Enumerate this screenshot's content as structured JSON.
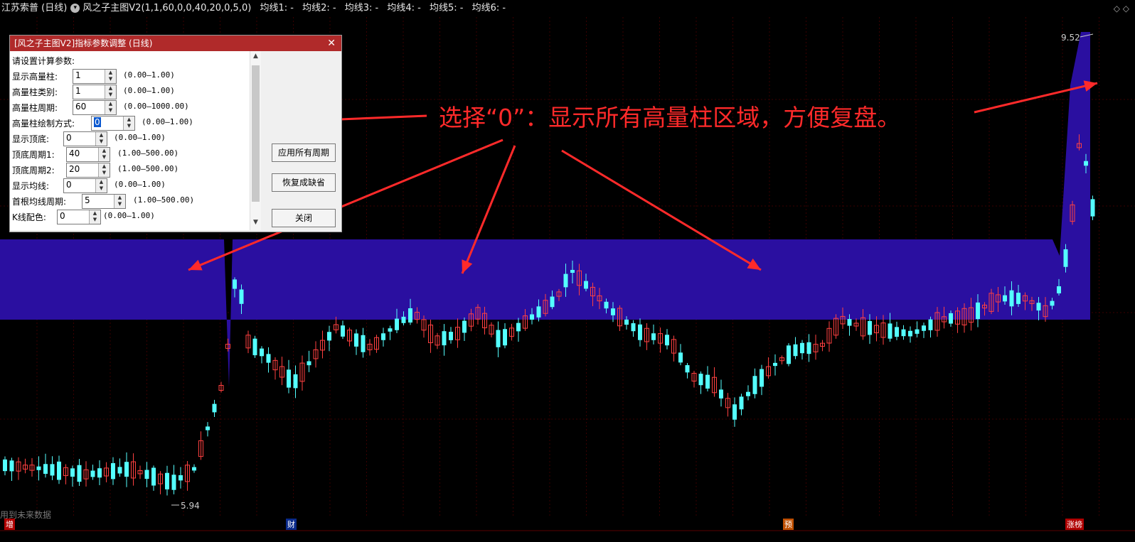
{
  "header": {
    "stock_name": "江苏索普 (日线)",
    "indicator_icon": "chevron-circle-icon",
    "indicator": "风之子主图V2(1,1,60,0,0,40,20,0,5,0)",
    "mas": [
      "均线1: -",
      "均线2: -",
      "均线3: -",
      "均线4: -",
      "均线5: -",
      "均线6: -"
    ],
    "corner": "◇ ◇"
  },
  "chart": {
    "high_label": "9.52",
    "low_label": "5.94",
    "colors": {
      "up": "#ff4040",
      "down": "#54ffff",
      "zone": "#2a0fa0",
      "grid": "#3a0000"
    }
  },
  "annotation": {
    "text": "选择“0”：显示所有高量柱区域，方便复盘。",
    "color": "#ff2a2a"
  },
  "dialog": {
    "title": "[风之子主图V2]指标参数调整 (日线)",
    "close_icon": "close-icon",
    "intro": "请设置计算参数:",
    "params": [
      {
        "label": "显示高量柱:",
        "value": "1",
        "range": "(0.00—1.00)"
      },
      {
        "label": "高量柱类别:",
        "value": "1",
        "range": "(0.00—1.00)"
      },
      {
        "label": "高量柱周期:",
        "value": "60",
        "range": "(0.00—1000.00)"
      },
      {
        "label": "高量柱绘制方式:",
        "value": "0",
        "range": "(0.00—1.00)"
      },
      {
        "label": "显示顶底:",
        "value": "0",
        "range": "(0.00—1.00)"
      },
      {
        "label": "顶底周期1:",
        "value": "40",
        "range": "(1.00—500.00)"
      },
      {
        "label": "顶底周期2:",
        "value": "20",
        "range": "(1.00—500.00)"
      },
      {
        "label": "显示均线:",
        "value": "0",
        "range": "(0.00—1.00)"
      },
      {
        "label": "首根均线周期:",
        "value": "5",
        "range": "(1.00—500.00)"
      },
      {
        "label": "K线配色:",
        "value": "0",
        "range": "(0.00—1.00)"
      }
    ],
    "buttons": {
      "apply_all": "应用所有周期",
      "restore": "恢复成缺省",
      "close": "关闭"
    }
  },
  "footer": {
    "future_data": "用到未来数据",
    "markers": [
      "增",
      "财",
      "预",
      "涨榜"
    ]
  }
}
